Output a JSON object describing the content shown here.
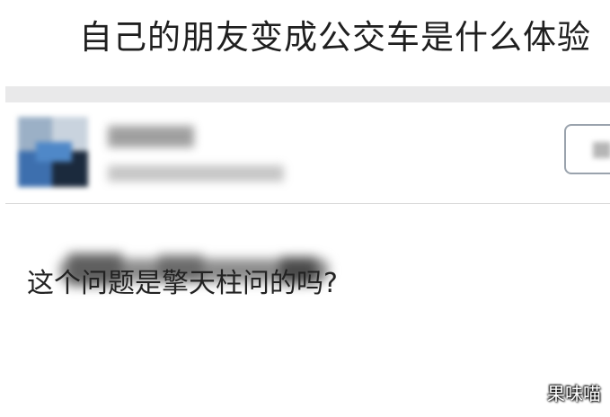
{
  "question": {
    "title": "自己的朋友变成公交车是什么体验"
  },
  "answer": {
    "author_avatar": "avatar-image",
    "follow_button_icon": "follow-icon",
    "body_text": "这个问题是擎天柱问的吗?"
  },
  "watermark": {
    "text": "果味喵"
  }
}
